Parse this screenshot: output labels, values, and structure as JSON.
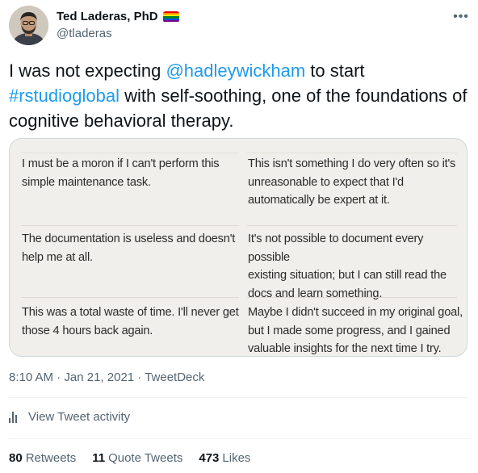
{
  "author": {
    "display_name": "Ted Laderas, PhD",
    "handle": "@tladeras",
    "flag_icon": "rainbow-flag-icon"
  },
  "more_icon": "more-options-icon",
  "tweet": {
    "text_parts": [
      {
        "text": "I was not expecting ",
        "link": false
      },
      {
        "text": "@hadleywickham",
        "link": true
      },
      {
        "text": " to start ",
        "link": false
      },
      {
        "text": "#rstudioglobal",
        "link": true
      },
      {
        "text": " with self-soothing, one of the foundations of cognitive behavioral therapy.",
        "link": false
      }
    ]
  },
  "media": {
    "rows": [
      {
        "left": [
          "I must be a moron if I can't perform this",
          "simple maintenance task."
        ],
        "right": [
          "This isn't something I do very often so it's",
          "unreasonable to expect that I'd",
          "automatically be expert at it."
        ]
      },
      {
        "left": [
          "The documentation is useless and doesn't",
          "help me at all."
        ],
        "right": [
          "It's not possible to document every possible",
          "existing situation; but I can still read the",
          "docs and learn something."
        ]
      },
      {
        "left": [
          "This was a total waste of time. I'll never get",
          "those 4 hours back again."
        ],
        "right": [
          "Maybe I didn't succeed in my original goal,",
          "but I made some progress, and I gained",
          "valuable insights for the next time I try."
        ]
      }
    ]
  },
  "meta": {
    "time": "8:10 AM",
    "separator": " · ",
    "date": "Jan 21, 2021",
    "source": "TweetDeck"
  },
  "activity": {
    "icon": "analytics-icon",
    "label": "View Tweet activity"
  },
  "stats": {
    "retweets_count": "80",
    "retweets_label": "Retweets",
    "quotes_count": "11",
    "quotes_label": "Quote Tweets",
    "likes_count": "473",
    "likes_label": "Likes"
  },
  "colors": {
    "link": "#1d9bf0",
    "secondary_text": "#536471",
    "media_background": "#f1efeb"
  }
}
